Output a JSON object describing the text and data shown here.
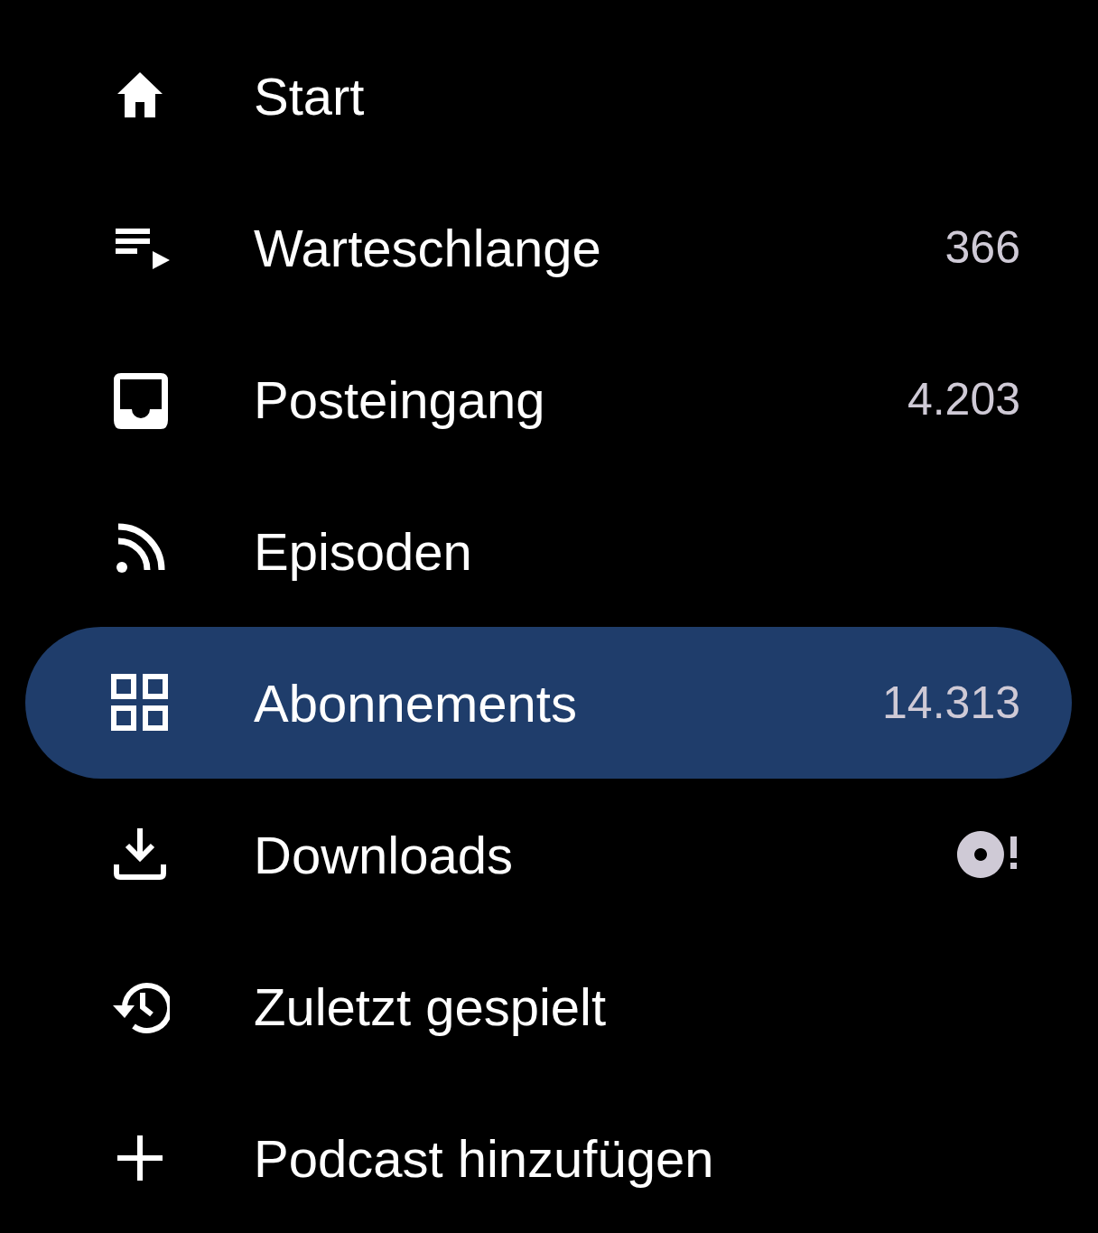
{
  "menu": {
    "items": [
      {
        "label": "Start",
        "kind": "plain",
        "selected": false
      },
      {
        "label": "Warteschlange",
        "kind": "count",
        "count": "366",
        "selected": false
      },
      {
        "label": "Posteingang",
        "kind": "count",
        "count": "4.203",
        "selected": false
      },
      {
        "label": "Episoden",
        "kind": "plain",
        "selected": false
      },
      {
        "label": "Abonnements",
        "kind": "count",
        "count": "14.313",
        "selected": true
      },
      {
        "label": "Downloads",
        "kind": "status",
        "selected": false
      },
      {
        "label": "Zuletzt gespielt",
        "kind": "plain",
        "selected": false
      },
      {
        "label": "Podcast hinzufügen",
        "kind": "plain",
        "selected": false
      }
    ]
  }
}
